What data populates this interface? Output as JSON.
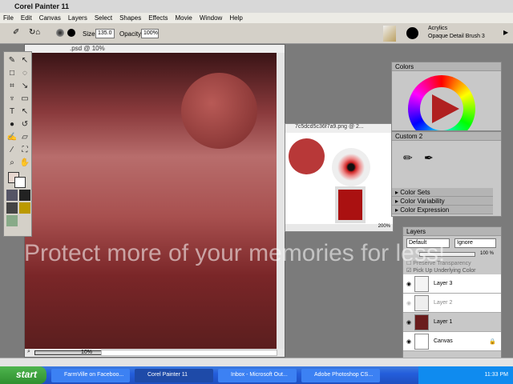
{
  "app": {
    "title": "Corel Painter 11"
  },
  "menu": [
    "File",
    "Edit",
    "Canvas",
    "Layers",
    "Select",
    "Shapes",
    "Effects",
    "Movie",
    "Window",
    "Help"
  ],
  "toolbar": {
    "size_label": "Size:",
    "size_value": "135.0",
    "opacity_label": "Opacity:",
    "opacity_value": "100%",
    "brush_category": "Acrylics",
    "brush_variant": "Opaque Detail Brush 3"
  },
  "document": {
    "title": ".psd @ 10%",
    "zoom": "10%"
  },
  "image_window": {
    "title": "7c5dcd5c36f7a9.png @ 2...",
    "zoom": "200%"
  },
  "colors_panel": {
    "title": "Colors"
  },
  "custom_panel": {
    "title": "Custom 2",
    "sections": [
      "Color Sets",
      "Color Variability",
      "Color Expression"
    ]
  },
  "layers_panel": {
    "title": "Layers",
    "composite_method": "Default",
    "composite_depth": "Ignore",
    "opacity": "100 %",
    "preserve_transparency": "Preserve Transparency",
    "pick_up_color": "Pick Up Underlying Color",
    "layers": [
      {
        "name": "Layer 3"
      },
      {
        "name": "Layer 2"
      },
      {
        "name": "Layer 1"
      },
      {
        "name": "Canvas"
      }
    ]
  },
  "taskbar": {
    "start": "start",
    "tasks": [
      "FarmVille on Faceboo...",
      "Corel Painter 11",
      "Inbox - Microsoft Out...",
      "Adobe Photoshop CS..."
    ],
    "clock": "11:33 PM"
  },
  "watermark": "Protect more of your memories for less!"
}
